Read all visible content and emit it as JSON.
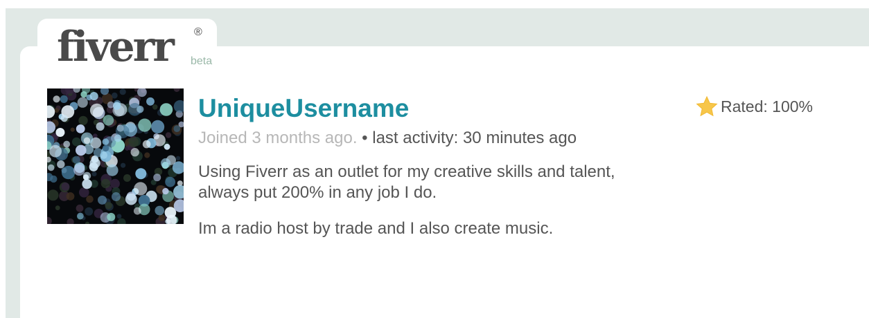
{
  "branding": {
    "logo_text": "fiverr",
    "registered_mark": "®",
    "badge": "beta"
  },
  "profile": {
    "username": "UniqueUsername",
    "joined": "Joined 3 months ago.",
    "separator": "•",
    "last_activity": "last activity: 30 minutes ago",
    "bio": [
      "Using Fiverr as an outlet for my creative skills and talent, always put 200% in any job I do.",
      "Im a radio host by trade and I also create music."
    ],
    "avatar_icon": "bokeh-lights-photo"
  },
  "rating": {
    "icon": "star-icon",
    "label": "Rated: 100%"
  },
  "colors": {
    "frame_bg": "#e1e9e6",
    "username": "#1d8ea0",
    "muted_text": "#b7b7b7",
    "body_text": "#555555",
    "star": "#f7c64a",
    "logo": "#4a4a4a",
    "beta": "#9ab8a8"
  }
}
